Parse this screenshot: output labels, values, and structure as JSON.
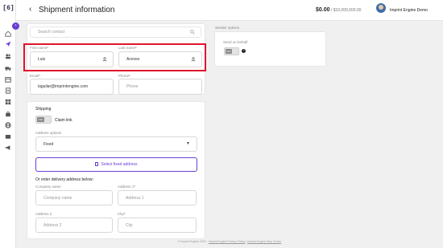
{
  "app": {
    "logo": "[6]"
  },
  "header": {
    "title": "Shipment information",
    "balance": "$0.00",
    "balance_limit": " / $10,000,000.00",
    "user_name": "Imprint Engine Demo"
  },
  "search": {
    "placeholder": "Search contact"
  },
  "form": {
    "first_name": {
      "label": "First name",
      "value": "Luis"
    },
    "last_name": {
      "label": "Last name",
      "value": "Aceves"
    },
    "email": {
      "label": "Email",
      "value": "laguilar@imprintengine.com"
    },
    "phone": {
      "label": "Phone",
      "placeholder": "Phone"
    },
    "shipping": {
      "title": "Shipping",
      "toggle_label": "OFF",
      "claim_link_label": "Claim link",
      "address_options_label": "Address options",
      "address_option_value": "Fixed",
      "select_fixed_button": "Select fixed address",
      "manual_title": "Or enter delivery address below:",
      "company_label": "Company name",
      "company_placeholder": "Company name",
      "address1_label": "Address 1",
      "address1_placeholder": "Address 1",
      "address2_label": "Address 2",
      "address2_placeholder": "Address 2",
      "city_label": "City",
      "city_placeholder": "City"
    }
  },
  "sender": {
    "title": "Sender options",
    "send_on_behalf_label": "Send on behalf",
    "toggle_label": "OFF"
  },
  "footer": {
    "copyright": "© Imprint Engine 2024",
    "privacy": "Imprint Engine Privacy Policy",
    "help": "Imprint Engine Help Center"
  },
  "colors": {
    "accent": "#6a3fd4",
    "highlight": "#e0142c"
  }
}
